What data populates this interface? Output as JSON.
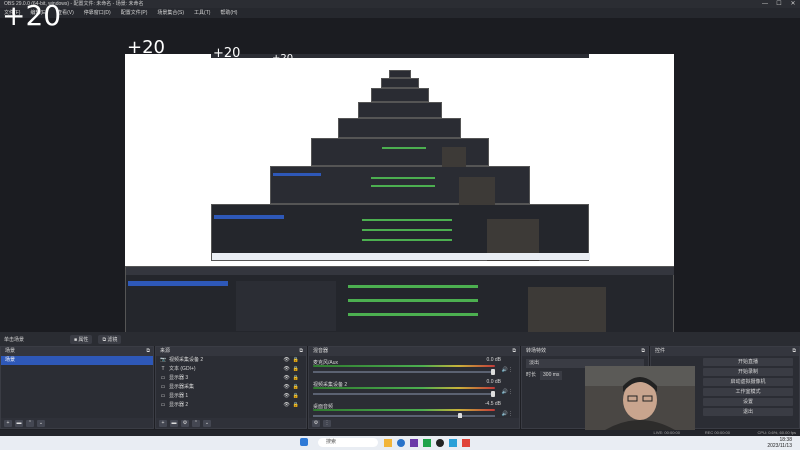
{
  "window": {
    "title": "OBS 29.0.0 (64-bit, windows) - 配置文件: 未命名 - 场景: 未命名",
    "controls": [
      "—",
      "☐",
      "✕"
    ]
  },
  "menu": [
    "文件(F)",
    "编辑(E)",
    "查看(V)",
    "停靠窗口(D)",
    "配置文件(P)",
    "场景集合(S)",
    "工具(T)",
    "帮助(H)"
  ],
  "overlay_fps": "+20",
  "scene_strip": {
    "label": "单击场景",
    "btn_a": "■ 属性",
    "btn_b": "⧉ 滤镜"
  },
  "scenes": {
    "title": "场景",
    "items": [
      "场景"
    ]
  },
  "sources": {
    "title": "来源",
    "items": [
      {
        "icon": "📷",
        "name": "视频采集设备 2"
      },
      {
        "icon": "T",
        "name": "文本 (GDI+)"
      },
      {
        "icon": "▭",
        "name": "显示器 3"
      },
      {
        "icon": "▭",
        "name": "显示器采集"
      },
      {
        "icon": "▭",
        "name": "显示器 1"
      },
      {
        "icon": "▭",
        "name": "显示器 2"
      }
    ]
  },
  "mixer": {
    "title": "混音器",
    "channels": [
      {
        "name": "麦克风/Aux",
        "db": "0.0 dB"
      },
      {
        "name": "视频采集设备 2",
        "db": "0.0 dB"
      },
      {
        "name": "桌面音频",
        "db": "-4.5 dB"
      }
    ]
  },
  "transitions": {
    "title": "转场特效",
    "type": "淡出",
    "duration_label": "时长",
    "duration": "300 ms"
  },
  "controls": {
    "title": "控件",
    "buttons": [
      "开始直播",
      "开始录制",
      "启动虚拟摄像机",
      "工作室模式",
      "设置",
      "退出"
    ]
  },
  "status": {
    "rec": "REC 00:00:00",
    "cpu": "CPU: 0.6%, 60.00 fps",
    "live": "LIVE: 00:00:00"
  },
  "taskbar": {
    "search": "搜索",
    "time": "18:38",
    "date": "2023/11/13"
  },
  "colors": {
    "selection": "#2e58b8",
    "dock_bg": "#2b2d34",
    "taskbar": "#e9edf3"
  }
}
